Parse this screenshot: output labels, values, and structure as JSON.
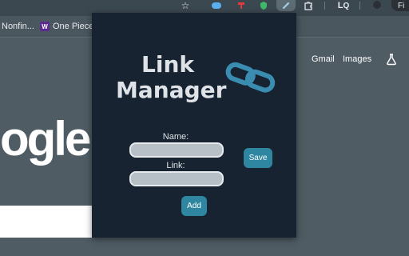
{
  "bookmarks": [
    {
      "label": "Nonfin..."
    },
    {
      "label": "One Piece",
      "favicon": "W"
    }
  ],
  "google": {
    "gmail": "Gmail",
    "images": "Images",
    "logo_fragment": "ogle"
  },
  "popup": {
    "title_line1": "Link",
    "title_line2": "Manager",
    "name_label": "Name:",
    "link_label": "Link:",
    "name_value": "",
    "link_value": "",
    "save_label": "Save",
    "add_label": "Add"
  },
  "toolbar": {
    "profile_fragment": "Fi"
  },
  "colors": {
    "popup_bg": "#172331",
    "accent": "#2f86a0",
    "chain_icon": "#3a8db1"
  }
}
